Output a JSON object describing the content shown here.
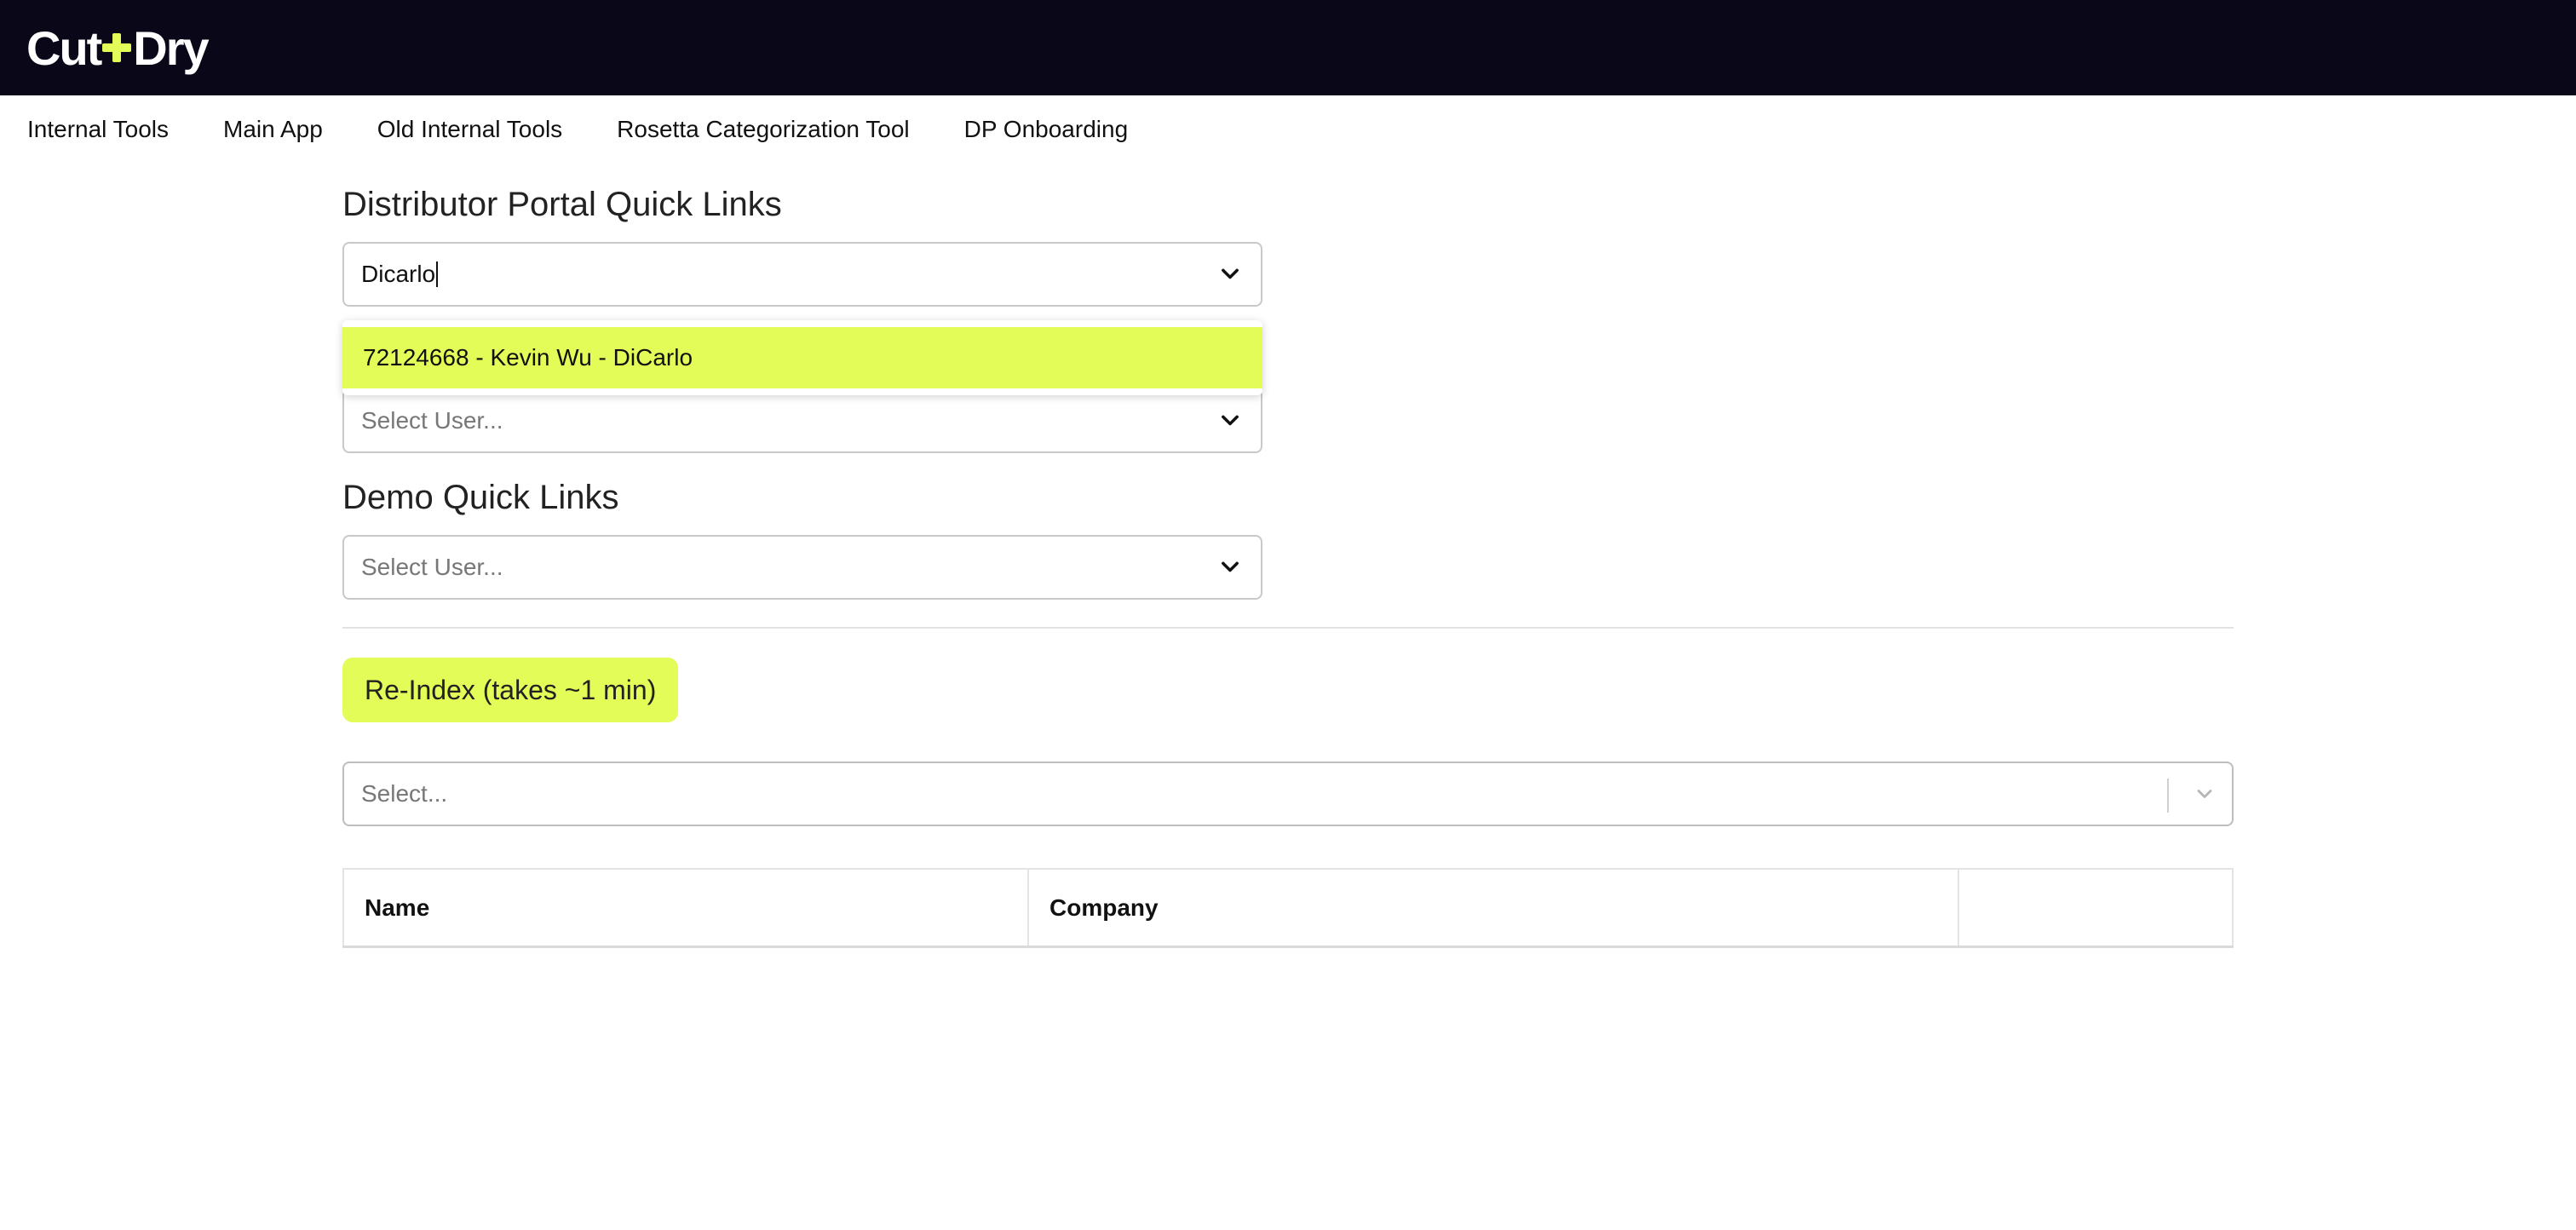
{
  "header": {
    "logo_left": "Cut",
    "logo_right": "Dry"
  },
  "nav": [
    {
      "label": "Internal Tools"
    },
    {
      "label": "Main App"
    },
    {
      "label": "Old Internal Tools"
    },
    {
      "label": "Rosetta Categorization Tool"
    },
    {
      "label": "DP Onboarding"
    }
  ],
  "distributor_portal": {
    "title": "Distributor Portal Quick Links",
    "input_value": "Dicarlo",
    "options": [
      {
        "label": "72124668 - Kevin Wu - DiCarlo"
      }
    ]
  },
  "second_select": {
    "placeholder": "Select User..."
  },
  "demo": {
    "title": "Demo Quick Links",
    "placeholder": "Select User..."
  },
  "reindex": {
    "label": "Re-Index (takes ~1 min)"
  },
  "wide_select": {
    "placeholder": "Select..."
  },
  "table": {
    "columns": [
      "Name",
      "Company",
      ""
    ]
  },
  "colors": {
    "brand_dark": "#0a0818",
    "accent": "#e3fc58"
  }
}
